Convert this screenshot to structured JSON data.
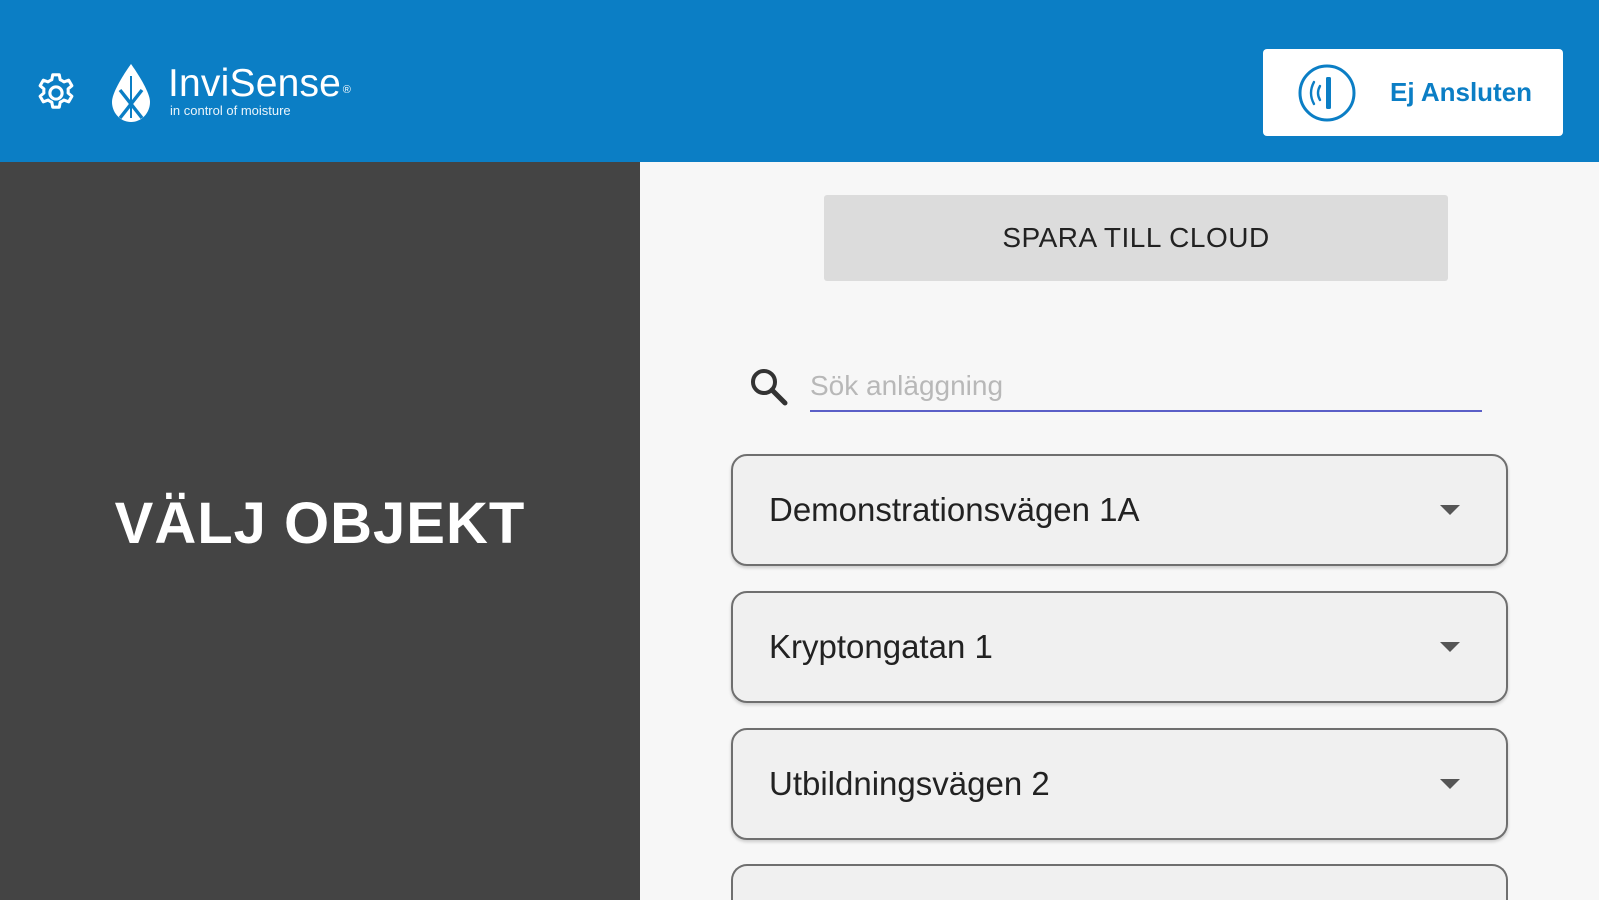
{
  "header": {
    "brand_color": "#0b7ec5",
    "settings_icon": "gear-icon",
    "logo": {
      "name": "InviSense",
      "registered": "®",
      "tagline": "in control of moisture"
    },
    "connection": {
      "icon": "sensor-signal-icon",
      "status_label": "Ej Ansluten"
    }
  },
  "left_panel": {
    "title": "VÄLJ OBJEKT",
    "background": "#444444"
  },
  "main": {
    "save_button_label": "SPARA TILL CLOUD",
    "search": {
      "icon": "search-icon",
      "placeholder": "Sök anläggning",
      "value": ""
    },
    "sites": [
      {
        "label": "Demonstrationsvägen 1A",
        "icon": "chevron-down-icon"
      },
      {
        "label": "Kryptongatan 1",
        "icon": "chevron-down-icon"
      },
      {
        "label": "Utbildningsvägen 2",
        "icon": "chevron-down-icon"
      },
      {
        "label": "",
        "icon": "chevron-down-icon"
      }
    ]
  }
}
